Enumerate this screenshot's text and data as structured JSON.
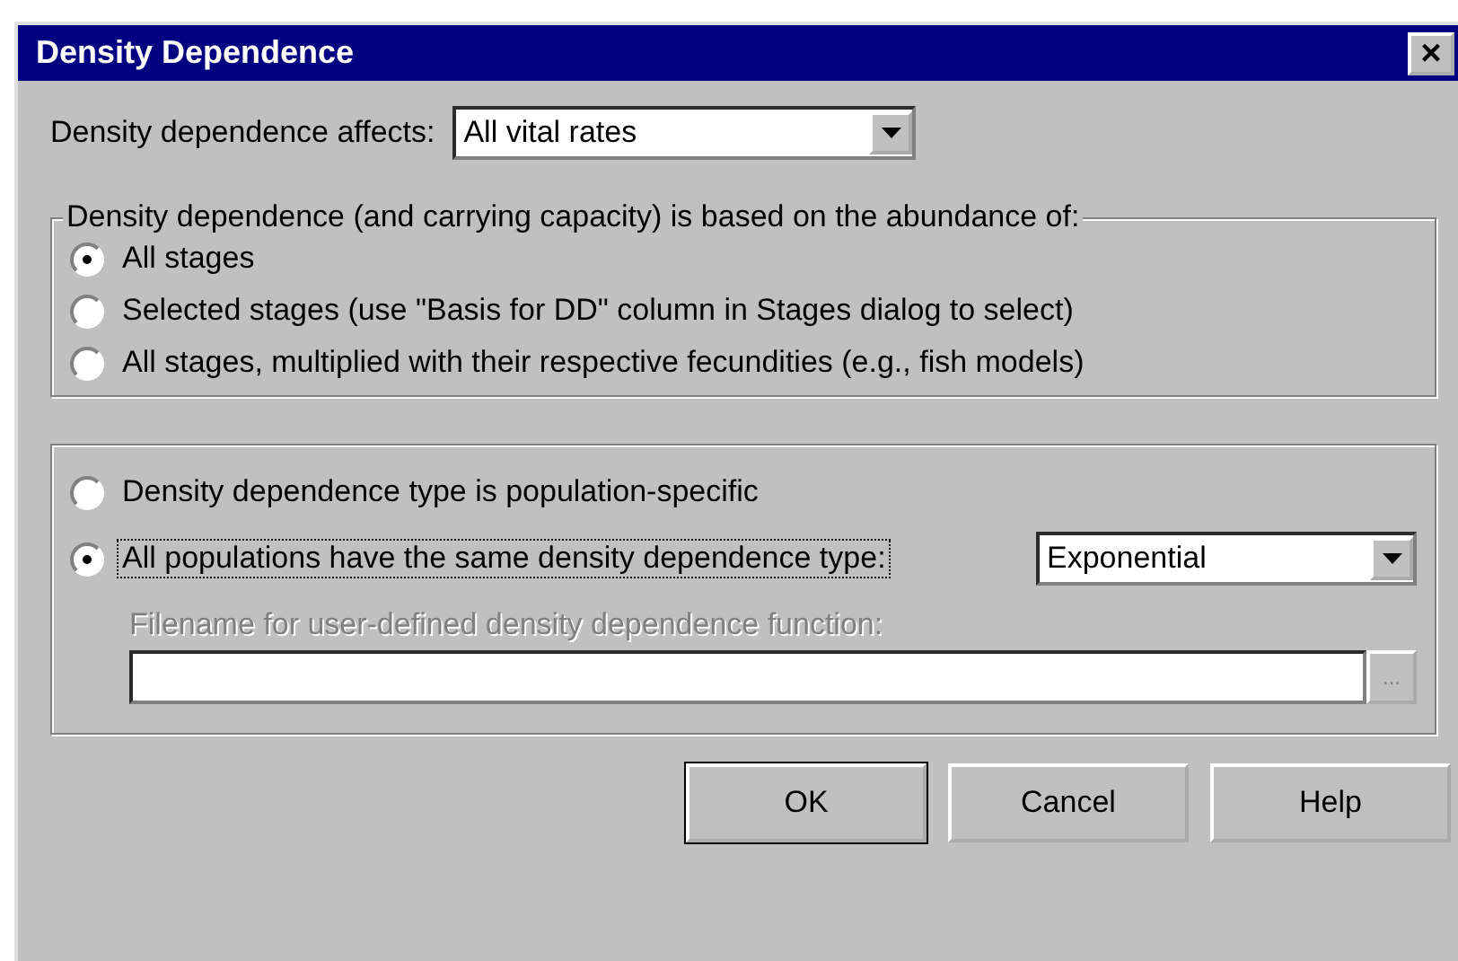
{
  "window": {
    "title": "Density Dependence",
    "close": "×"
  },
  "affects": {
    "label": "Density dependence affects:",
    "value": "All vital rates"
  },
  "basis": {
    "legend": "Density dependence (and carrying capacity) is based on the abundance of:",
    "options": [
      {
        "label": "All stages",
        "selected": true
      },
      {
        "label": "Selected stages (use \"Basis for DD\" column in Stages dialog to select)",
        "selected": false
      },
      {
        "label": "All stages, multiplied with their respective fecundities (e.g., fish models)",
        "selected": false
      }
    ]
  },
  "type": {
    "options": [
      {
        "label": "Density dependence type is population-specific",
        "selected": false,
        "focused": false
      },
      {
        "label": "All populations have the same density dependence type:",
        "selected": true,
        "focused": true
      }
    ],
    "value": "Exponential",
    "file": {
      "label": "Filename for user-defined density dependence function:",
      "disabled": true,
      "browse": "..."
    }
  },
  "buttons": [
    {
      "label": "OK",
      "default": true
    },
    {
      "label": "Cancel",
      "default": false
    },
    {
      "label": "Help",
      "default": false
    }
  ]
}
